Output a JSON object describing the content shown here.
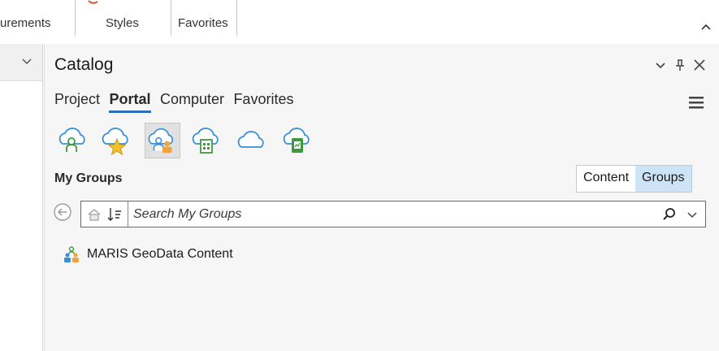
{
  "ribbon": {
    "groups": [
      "urements",
      "Styles",
      "Favorites"
    ]
  },
  "catalog": {
    "title": "Catalog",
    "tabs": [
      {
        "label": "Project",
        "active": false
      },
      {
        "label": "Portal",
        "active": true
      },
      {
        "label": "Computer",
        "active": false
      },
      {
        "label": "Favorites",
        "active": false
      }
    ],
    "portal_icons": [
      {
        "name": "my-content-cloud-icon",
        "selected": false
      },
      {
        "name": "my-favorites-cloud-icon",
        "selected": false
      },
      {
        "name": "my-groups-cloud-icon",
        "selected": true
      },
      {
        "name": "my-organization-cloud-icon",
        "selected": false
      },
      {
        "name": "all-portal-cloud-icon",
        "selected": false
      },
      {
        "name": "living-atlas-cloud-icon",
        "selected": false
      }
    ],
    "section_label": "My Groups",
    "view_toggle": {
      "content": "Content",
      "groups": "Groups",
      "active": "Groups"
    },
    "search": {
      "placeholder": "Search My Groups",
      "value": ""
    },
    "items": [
      {
        "label": "MARIS GeoData Content",
        "icon": "group-icon"
      }
    ]
  },
  "colors": {
    "accent": "#2a6ebb",
    "toggle_active": "#cde4f7",
    "cloud_blue": "#3a8fd6",
    "group_green": "#3e9a3e",
    "group_orange": "#f3a23a",
    "star_yellow": "#f2c12e"
  }
}
